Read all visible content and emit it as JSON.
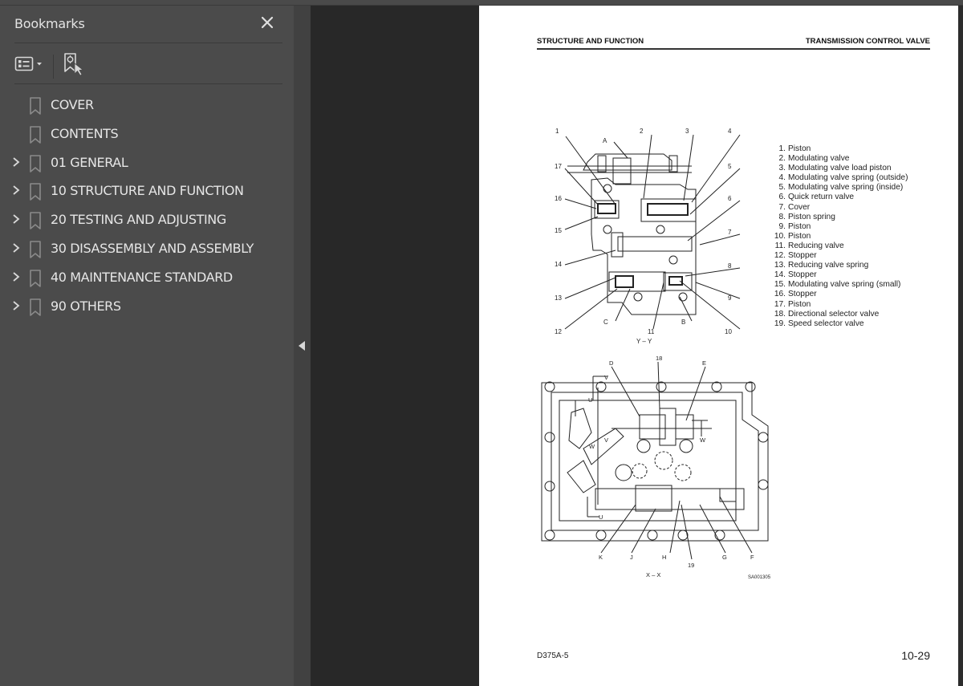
{
  "sidebar": {
    "title": "Bookmarks",
    "close_icon": "close-icon",
    "toolbar": {
      "options_icon": "bookmark-options-icon",
      "find_current_icon": "find-current-bookmark-icon"
    },
    "items": [
      {
        "label": "COVER",
        "expandable": false
      },
      {
        "label": "CONTENTS",
        "expandable": false
      },
      {
        "label": "01 GENERAL",
        "expandable": true
      },
      {
        "label": "10 STRUCTURE AND FUNCTION",
        "expandable": true
      },
      {
        "label": "20 TESTING AND ADJUSTING",
        "expandable": true
      },
      {
        "label": "30 DISASSEMBLY AND ASSEMBLY",
        "expandable": true
      },
      {
        "label": "40 MAINTENANCE STANDARD",
        "expandable": true
      },
      {
        "label": "90 OTHERS",
        "expandable": true
      }
    ]
  },
  "collapse_handle": {
    "icon": "collapse-left-icon"
  },
  "page": {
    "header_left": "STRUCTURE AND FUNCTION",
    "header_right": "TRANSMISSION CONTROL VALVE",
    "legend": [
      {
        "num": "1.",
        "text": "Piston"
      },
      {
        "num": "2.",
        "text": "Modulating valve"
      },
      {
        "num": "3.",
        "text": "Modulating valve load piston"
      },
      {
        "num": "4.",
        "text": "Modulating valve spring (outside)"
      },
      {
        "num": "5.",
        "text": "Modulating valve spring (inside)"
      },
      {
        "num": "6.",
        "text": "Quick return valve"
      },
      {
        "num": "7.",
        "text": "Cover"
      },
      {
        "num": "8.",
        "text": "Piston spring"
      },
      {
        "num": "9.",
        "text": "Piston"
      },
      {
        "num": "10.",
        "text": "Piston"
      },
      {
        "num": "11.",
        "text": "Reducing valve"
      },
      {
        "num": "12.",
        "text": "Stopper"
      },
      {
        "num": "13.",
        "text": "Reducing valve spring"
      },
      {
        "num": "14.",
        "text": "Stopper"
      },
      {
        "num": "15.",
        "text": "Modulating valve spring (small)"
      },
      {
        "num": "16.",
        "text": "Stopper"
      },
      {
        "num": "17.",
        "text": "Piston"
      },
      {
        "num": "18.",
        "text": "Directional selector valve"
      },
      {
        "num": "19.",
        "text": "Speed selector valve"
      }
    ],
    "figure1": {
      "section_label": "Y – Y",
      "callouts": [
        "1",
        "2",
        "3",
        "4",
        "5",
        "6",
        "7",
        "8",
        "9",
        "10",
        "11",
        "12",
        "13",
        "14",
        "15",
        "16",
        "17",
        "A",
        "B",
        "C"
      ]
    },
    "figure2": {
      "section_label": "X – X",
      "drawing_id": "SA001305",
      "callouts": [
        "18",
        "19",
        "D",
        "E",
        "F",
        "G",
        "H",
        "J",
        "K",
        "U",
        "V",
        "W"
      ]
    },
    "footer_left": "D375A-5",
    "footer_right": "10-29"
  }
}
